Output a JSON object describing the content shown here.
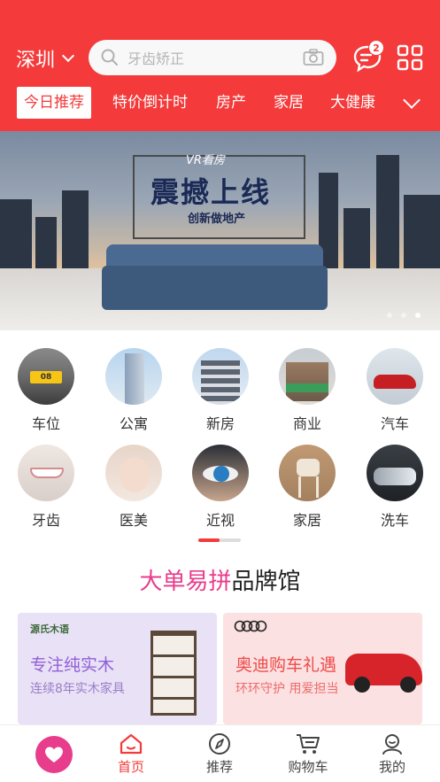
{
  "header": {
    "city": "深圳",
    "search_placeholder": "牙齿矫正",
    "message_badge": "2"
  },
  "tabs": [
    {
      "label": "今日推荐",
      "active": true
    },
    {
      "label": "特价倒计时"
    },
    {
      "label": "房产"
    },
    {
      "label": "家居"
    },
    {
      "label": "大健康"
    }
  ],
  "banner": {
    "tag": "VR看房",
    "title": "震撼上线",
    "subtitle": "创新做地产",
    "slide_count": 3,
    "active_slide": 3
  },
  "categories": [
    {
      "label": "车位",
      "icon": "parking-spot-photo"
    },
    {
      "label": "公寓",
      "icon": "apartment-photo"
    },
    {
      "label": "新房",
      "icon": "new-house-photo"
    },
    {
      "label": "商业",
      "icon": "commercial-photo"
    },
    {
      "label": "汽车",
      "icon": "car-photo"
    },
    {
      "label": "牙齿",
      "icon": "teeth-photo"
    },
    {
      "label": "医美",
      "icon": "beauty-photo"
    },
    {
      "label": "近视",
      "icon": "eye-photo"
    },
    {
      "label": "家居",
      "icon": "furniture-photo"
    },
    {
      "label": "洗车",
      "icon": "car-wash-photo"
    }
  ],
  "brand_section": {
    "title_highlight": "大单易拼",
    "title_rest": "品牌馆"
  },
  "cards": [
    {
      "logo": "源氏木语",
      "title": "专注纯实木",
      "subtitle": "连续8年实木家具"
    },
    {
      "logo": "",
      "title": "奥迪购车礼遇",
      "subtitle": "环环守护 用爱担当"
    }
  ],
  "tabbar": [
    {
      "label": "首页",
      "active": true
    },
    {
      "label": "推荐"
    },
    {
      "label": "购物车"
    },
    {
      "label": "我的"
    }
  ],
  "colors": {
    "primary": "#f43a3a",
    "brand_pink": "#e83c8c",
    "card1_bg": "#e9e1f6",
    "card2_bg": "#fbe1e1"
  }
}
